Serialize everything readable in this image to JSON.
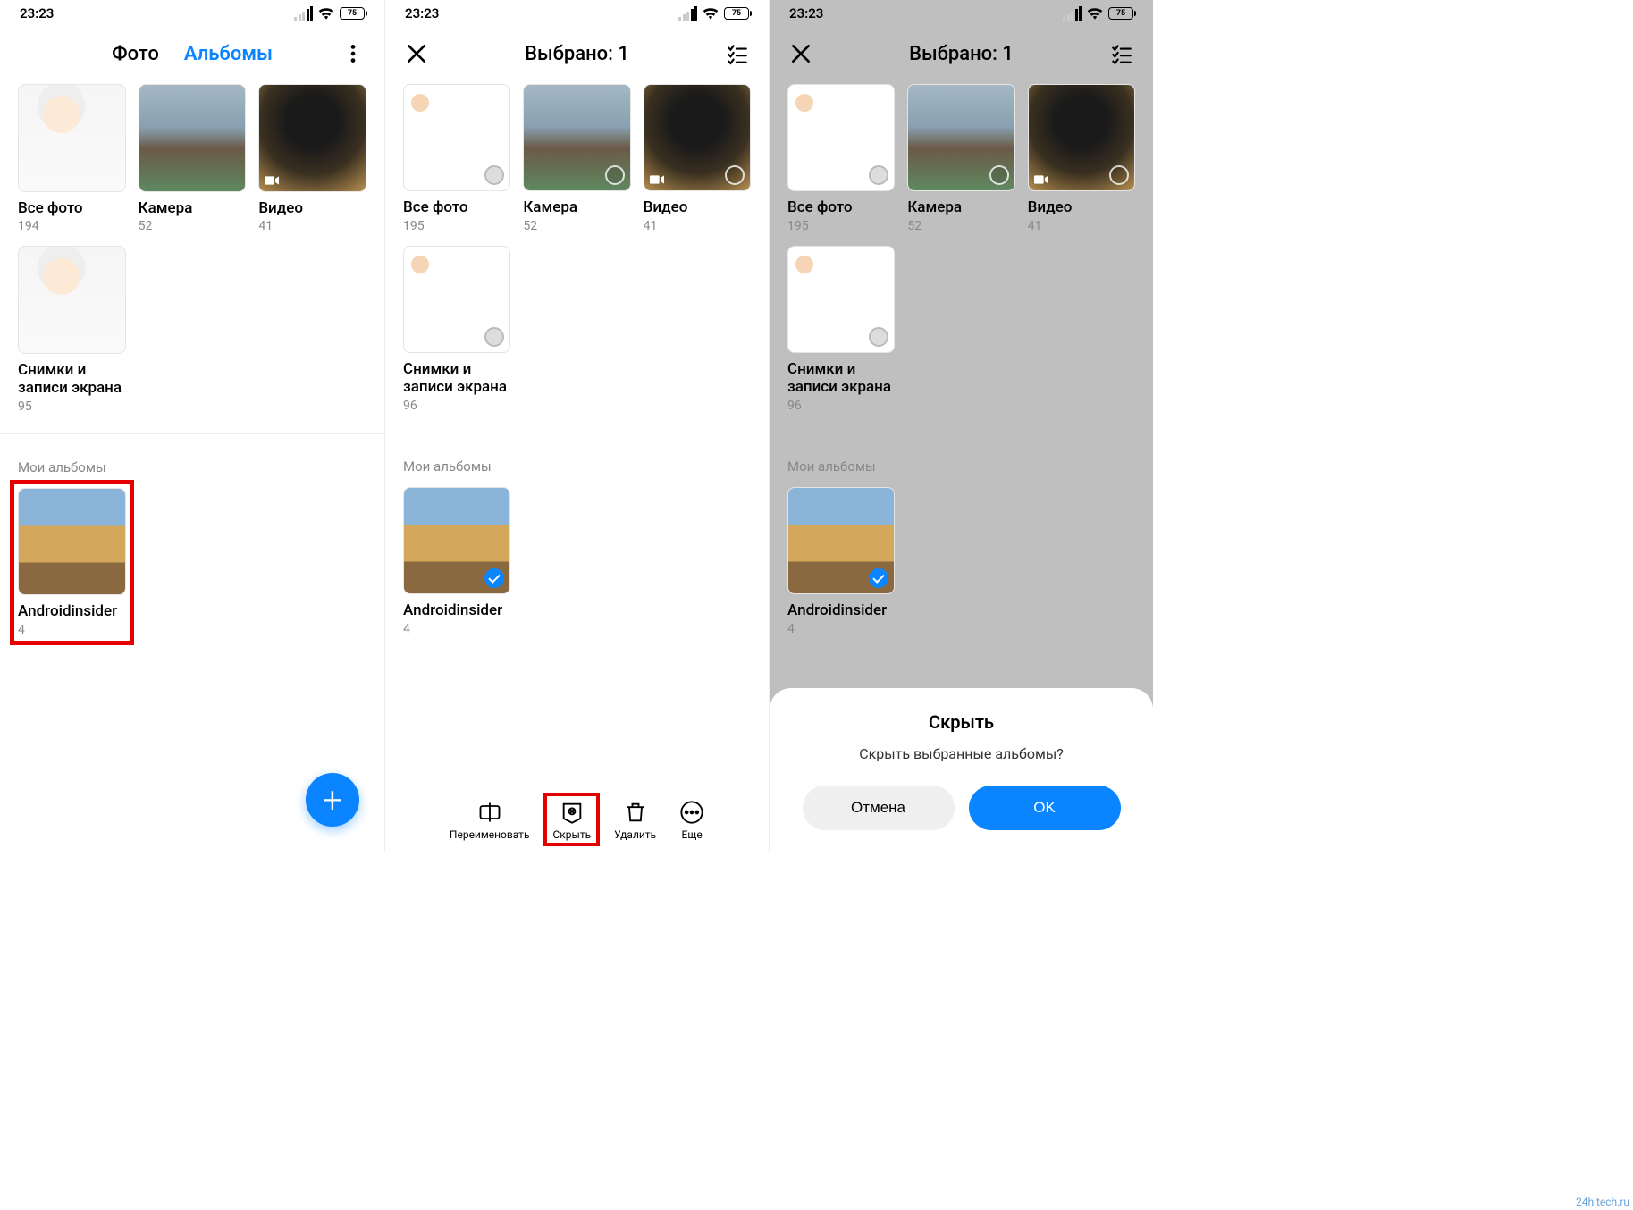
{
  "status": {
    "time": "23:23",
    "battery": "75"
  },
  "screen1": {
    "tabs": {
      "photo": "Фото",
      "albums": "Альбомы"
    },
    "albums_top": [
      {
        "title": "Все фото",
        "count": "194"
      },
      {
        "title": "Камера",
        "count": "52"
      },
      {
        "title": "Видео",
        "count": "41"
      },
      {
        "title": "Снимки и записи экрана",
        "count": "95"
      }
    ],
    "section": "Мои альбомы",
    "albums_my": [
      {
        "title": "Androidinsider",
        "count": "4"
      }
    ]
  },
  "screen2": {
    "title": "Выбрано: 1",
    "albums_top": [
      {
        "title": "Все фото",
        "count": "195"
      },
      {
        "title": "Камера",
        "count": "52"
      },
      {
        "title": "Видео",
        "count": "41"
      },
      {
        "title": "Снимки и записи экрана",
        "count": "96"
      }
    ],
    "section": "Мои альбомы",
    "albums_my": [
      {
        "title": "Androidinsider",
        "count": "4"
      }
    ],
    "toolbar": {
      "rename": "Переименовать",
      "hide": "Скрыть",
      "delete": "Удалить",
      "more": "Еще"
    }
  },
  "screen3": {
    "title": "Выбрано: 1",
    "albums_top": [
      {
        "title": "Все фото",
        "count": "195"
      },
      {
        "title": "Камера",
        "count": "52"
      },
      {
        "title": "Видео",
        "count": "41"
      },
      {
        "title": "Снимки и записи экрана",
        "count": "96"
      }
    ],
    "section": "Мои альбомы",
    "albums_my": [
      {
        "title": "Androidinsider",
        "count": "4"
      }
    ],
    "sheet": {
      "title": "Скрыть",
      "message": "Скрыть выбранные альбомы?",
      "cancel": "Отмена",
      "ok": "OK"
    }
  },
  "watermark": "24hitech.ru"
}
